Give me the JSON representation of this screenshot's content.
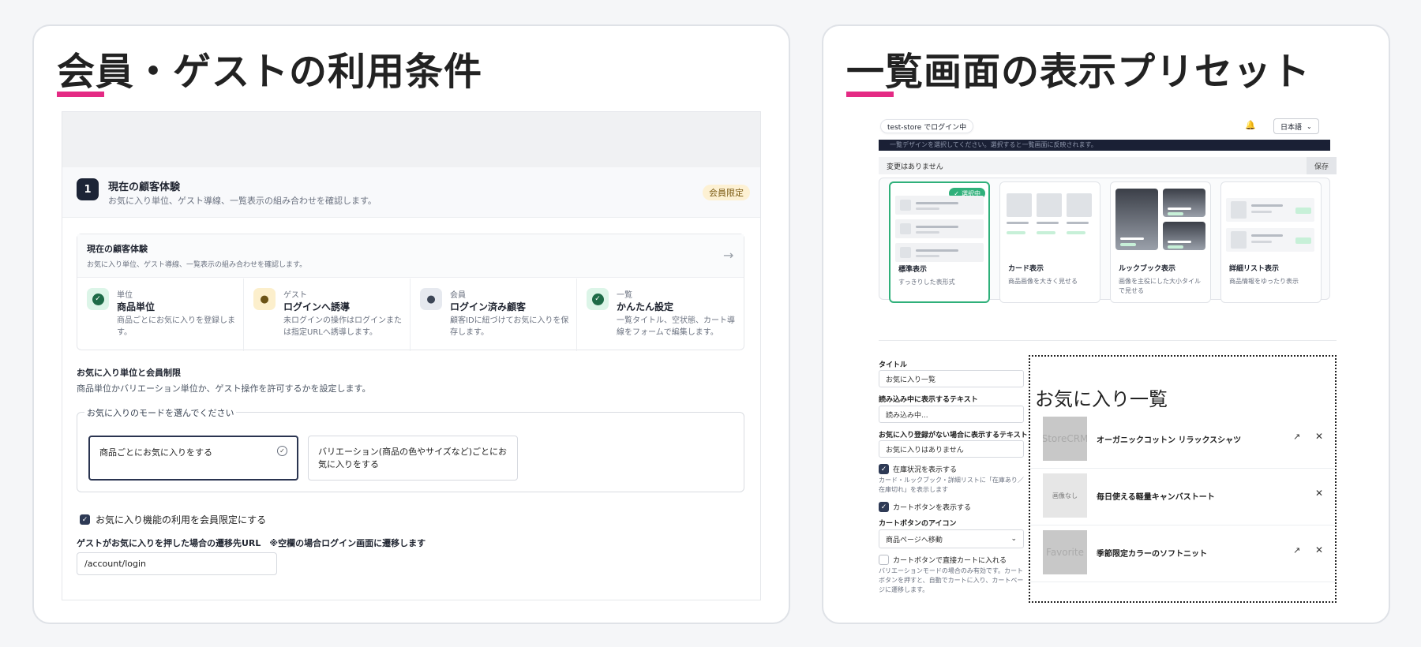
{
  "left": {
    "title": "会員・ゲストの利用条件",
    "step_number": "1",
    "section_title": "現在の顧客体験",
    "section_subtitle": "お気に入り単位、ゲスト導線、一覧表示の組み合わせを確認します。",
    "badge": "会員限定",
    "experience": {
      "title": "現在の顧客体験",
      "subtitle": "お気に入り単位、ゲスト導線、一覧表示の組み合わせを確認します。",
      "cells": [
        {
          "tag": "単位",
          "name": "商品単位",
          "desc": "商品ごとにお気に入りを登録します。"
        },
        {
          "tag": "ゲスト",
          "name": "ログインへ誘導",
          "desc": "未ログインの操作はログインまたは指定URLへ誘導します。"
        },
        {
          "tag": "会員",
          "name": "ログイン済み顧客",
          "desc": "顧客IDに紐づけてお気に入りを保存します。"
        },
        {
          "tag": "一覧",
          "name": "かんたん設定",
          "desc": "一覧タイトル、空状態、カート導線をフォームで編集します。"
        }
      ]
    },
    "fav_section_title": "お気に入り単位と会員制限",
    "fav_section_desc": "商品単位かバリエーション単位か、ゲスト操作を許可するかを設定します。",
    "mode_legend": "お気に入りのモードを選んでください",
    "mode_options": [
      "商品ごとにお気に入りをする",
      "バリエーション(商品の色やサイズなど)ごとにお気に入りをする"
    ],
    "member_only_label": "お気に入り機能の利用を会員限定にする",
    "guest_url_label": "ゲストがお気に入りを押した場合の遷移先URL　※空欄の場合ログイン画面に遷移します",
    "guest_url_value": "/account/login"
  },
  "right": {
    "title": "一覧画面の表示プリセット",
    "login_pill": "test-store でログイン中",
    "language": "日本語",
    "dark_band_text": "一覧デザインを選択してください。選択すると一覧画面に反映されます。",
    "no_changes": "変更はありません",
    "save": "保存",
    "selected_badge": "選択中",
    "presets": [
      {
        "name": "標準表示",
        "desc": "すっきりした表形式"
      },
      {
        "name": "カード表示",
        "desc": "商品画像を大きく見せる"
      },
      {
        "name": "ルックブック表示",
        "desc": "画像を主役にした大小タイルで見せる"
      },
      {
        "name": "詳細リスト表示",
        "desc": "商品情報をゆったり表示"
      }
    ],
    "form": {
      "title_label": "タイトル",
      "title_value": "お気に入り一覧",
      "loading_label": "読み込み中に表示するテキスト",
      "loading_value": "読み込み中...",
      "empty_label": "お気に入り登録がない場合に表示するテキスト",
      "empty_value": "お気に入りはありません",
      "stock_label": "在庫状況を表示する",
      "stock_desc": "カード・ルックブック・詳細リストに「在庫あり／在庫切れ」を表示します",
      "cart_button_label": "カートボタンを表示する",
      "cart_icon_label": "カートボタンのアイコン",
      "cart_icon_value": "商品ページへ移動",
      "direct_cart_label": "カートボタンで直接カートに入れる",
      "direct_cart_desc": "バリエーションモードの場合のみ有効です。カートボタンを押すと、自動でカートに入り、カートページに遷移します。"
    },
    "preview": {
      "title": "お気に入り一覧",
      "items": [
        {
          "image_text": "StoreCRM",
          "name": "オーガニックコットン リラックスシャツ"
        },
        {
          "image_text": "画像なし",
          "name": "毎日使える軽量キャンバストート"
        },
        {
          "image_text": "Favorite",
          "name": "季節限定カラーのソフトニット"
        }
      ]
    }
  }
}
